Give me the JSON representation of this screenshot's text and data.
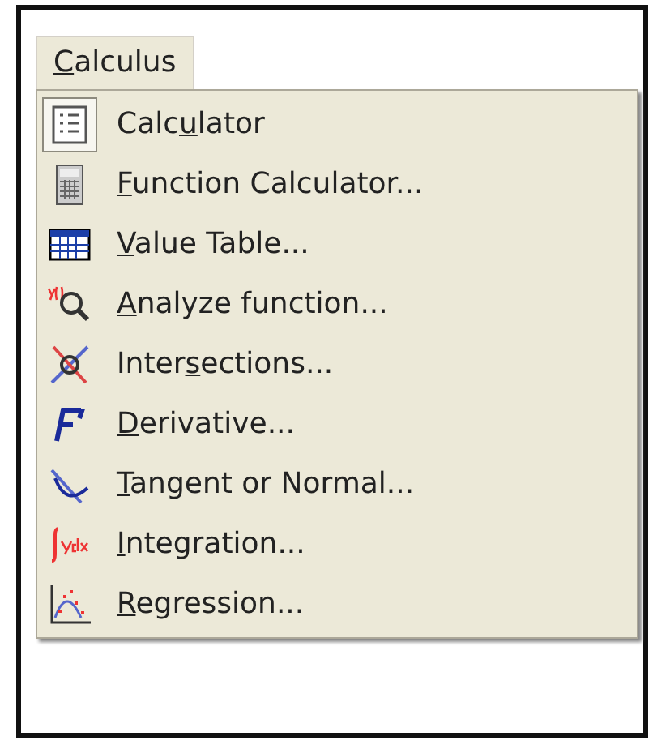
{
  "menu": {
    "title": {
      "key": "C",
      "after": "alculus"
    },
    "items": [
      {
        "kind": "calculator",
        "label": {
          "before": "Calc",
          "key": "u",
          "after": "lator"
        },
        "checked": true
      },
      {
        "kind": "function-calculator",
        "label": {
          "key": "F",
          "after": "unction Calculator..."
        },
        "checked": false
      },
      {
        "kind": "value-table",
        "label": {
          "key": "V",
          "after": "alue Table..."
        },
        "checked": false
      },
      {
        "kind": "analyze",
        "label": {
          "key": "A",
          "after": "nalyze function..."
        },
        "checked": false
      },
      {
        "kind": "intersections",
        "label": {
          "before": "Inter",
          "key": "s",
          "after": "ections..."
        },
        "checked": false
      },
      {
        "kind": "derivative",
        "label": {
          "key": "D",
          "after": "erivative..."
        },
        "checked": false
      },
      {
        "kind": "tangent",
        "label": {
          "key": "T",
          "after": "angent or Normal..."
        },
        "checked": false
      },
      {
        "kind": "integration",
        "label": {
          "key": "I",
          "after": "ntegration..."
        },
        "checked": false
      },
      {
        "kind": "regression",
        "label": {
          "key": "R",
          "after": "egression..."
        },
        "checked": false
      }
    ]
  }
}
